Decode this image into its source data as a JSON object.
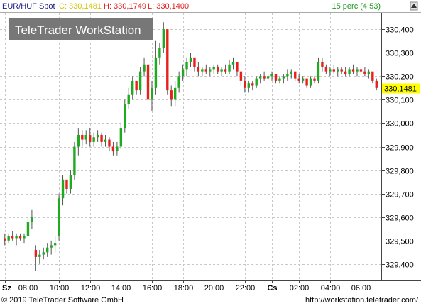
{
  "header": {
    "symbol": "EUR/HUF Spot",
    "close_label": "C: 330,1481",
    "high_label": "H: 330,1749",
    "low_label": "L: 330,1400",
    "interval": "15 perc (4:53)"
  },
  "watermark": "TeleTrader WorkStation",
  "footer": {
    "copyright": "© 2019 TeleTrader Software GmbH",
    "url": "http://workstation.teletrader.com/"
  },
  "colors": {
    "up": "#1faa1f",
    "down": "#e8201a",
    "wick": "#555555",
    "grid": "#c8c8c8",
    "last_price_bg": "#ffff00",
    "close_text": "#d4c400",
    "high_low_text": "#e02020",
    "interval_text": "#1f9a1f",
    "watermark_bg": "#777777"
  },
  "chart_data": {
    "type": "candlestick",
    "title": "EUR/HUF Spot",
    "interval": "15 perc",
    "ylim": [
      329.33,
      330.47
    ],
    "y_ticks": [
      "329,400",
      "329,500",
      "329,600",
      "329,700",
      "329,800",
      "329,900",
      "330,000",
      "330,100",
      "330,200",
      "330,300",
      "330,400"
    ],
    "x_ticks": [
      {
        "label": "Sz",
        "pos": 0,
        "bold": true
      },
      {
        "label": "08:00",
        "pos": 6
      },
      {
        "label": "10:00",
        "pos": 14
      },
      {
        "label": "12:00",
        "pos": 22
      },
      {
        "label": "14:00",
        "pos": 30
      },
      {
        "label": "16:00",
        "pos": 38
      },
      {
        "label": "18:00",
        "pos": 46
      },
      {
        "label": "20:00",
        "pos": 54
      },
      {
        "label": "22:00",
        "pos": 62
      },
      {
        "label": "Cs",
        "pos": 69,
        "bold": true
      },
      {
        "label": "02:00",
        "pos": 76
      },
      {
        "label": "04:00",
        "pos": 84
      },
      {
        "label": "06:00",
        "pos": 92
      }
    ],
    "last_price": "330,1481",
    "last_price_value": 330.1481,
    "ohlc": [
      [
        329.51,
        329.53,
        329.48,
        329.5
      ],
      [
        329.5,
        329.53,
        329.49,
        329.52
      ],
      [
        329.52,
        329.54,
        329.5,
        329.51
      ],
      [
        329.51,
        329.53,
        329.48,
        329.52
      ],
      [
        329.52,
        329.53,
        329.5,
        329.51
      ],
      [
        329.51,
        329.53,
        329.49,
        329.52
      ],
      [
        329.52,
        329.6,
        329.52,
        329.58
      ],
      [
        329.58,
        329.63,
        329.55,
        329.6
      ],
      [
        329.46,
        329.48,
        329.37,
        329.43
      ],
      [
        329.43,
        329.46,
        329.4,
        329.44
      ],
      [
        329.44,
        329.47,
        329.42,
        329.45
      ],
      [
        329.45,
        329.49,
        329.43,
        329.47
      ],
      [
        329.47,
        329.5,
        329.44,
        329.48
      ],
      [
        329.48,
        329.52,
        329.45,
        329.49
      ],
      [
        329.52,
        329.7,
        329.5,
        329.68
      ],
      [
        329.68,
        329.78,
        329.65,
        329.76
      ],
      [
        329.76,
        329.74,
        329.7,
        329.72
      ],
      [
        329.72,
        329.8,
        329.7,
        329.78
      ],
      [
        329.78,
        329.92,
        329.76,
        329.9
      ],
      [
        329.9,
        329.98,
        329.86,
        329.95
      ],
      [
        329.95,
        329.97,
        329.9,
        329.93
      ],
      [
        329.93,
        329.97,
        329.91,
        329.95
      ],
      [
        329.95,
        329.98,
        329.9,
        329.92
      ],
      [
        329.92,
        329.96,
        329.9,
        329.94
      ],
      [
        329.94,
        329.97,
        329.92,
        329.95
      ],
      [
        329.95,
        329.96,
        329.9,
        329.92
      ],
      [
        329.92,
        329.95,
        329.9,
        329.93
      ],
      [
        329.93,
        329.94,
        329.88,
        329.9
      ],
      [
        329.9,
        329.92,
        329.86,
        329.88
      ],
      [
        329.88,
        329.92,
        329.86,
        329.9
      ],
      [
        329.9,
        330.0,
        329.89,
        329.98
      ],
      [
        329.98,
        330.1,
        329.96,
        330.08
      ],
      [
        330.08,
        330.15,
        330.06,
        330.12
      ],
      [
        330.12,
        330.2,
        330.1,
        330.18
      ],
      [
        330.18,
        330.16,
        330.12,
        330.14
      ],
      [
        330.14,
        330.24,
        330.12,
        330.22
      ],
      [
        330.22,
        330.28,
        330.2,
        330.25
      ],
      [
        330.25,
        330.2,
        330.08,
        330.1
      ],
      [
        330.1,
        330.18,
        330.05,
        330.15
      ],
      [
        330.15,
        330.35,
        330.12,
        330.28
      ],
      [
        330.28,
        330.34,
        330.25,
        330.32
      ],
      [
        330.32,
        330.43,
        330.3,
        330.4
      ],
      [
        330.4,
        330.3,
        330.12,
        330.14
      ],
      [
        330.14,
        330.16,
        330.07,
        330.1
      ],
      [
        330.1,
        330.18,
        330.07,
        330.15
      ],
      [
        330.15,
        330.22,
        330.13,
        330.2
      ],
      [
        330.2,
        330.25,
        330.18,
        330.23
      ],
      [
        330.23,
        330.28,
        330.2,
        330.26
      ],
      [
        330.26,
        330.3,
        330.24,
        330.28
      ],
      [
        330.28,
        330.26,
        330.22,
        330.24
      ],
      [
        330.24,
        330.26,
        330.2,
        330.22
      ],
      [
        330.22,
        330.24,
        330.2,
        330.23
      ],
      [
        330.23,
        330.25,
        330.21,
        330.22
      ],
      [
        330.22,
        330.24,
        330.2,
        330.23
      ],
      [
        330.23,
        330.25,
        330.21,
        330.24
      ],
      [
        330.24,
        330.25,
        330.21,
        330.22
      ],
      [
        330.22,
        330.24,
        330.2,
        330.23
      ],
      [
        330.23,
        330.25,
        330.21,
        330.22
      ],
      [
        330.22,
        330.27,
        330.21,
        330.25
      ],
      [
        330.25,
        330.28,
        330.23,
        330.26
      ],
      [
        330.26,
        330.24,
        330.2,
        330.22
      ],
      [
        330.22,
        330.2,
        330.16,
        330.18
      ],
      [
        330.18,
        330.2,
        330.13,
        330.15
      ],
      [
        330.15,
        330.18,
        330.13,
        330.17
      ],
      [
        330.17,
        330.18,
        330.14,
        330.16
      ],
      [
        330.16,
        330.2,
        330.15,
        330.19
      ],
      [
        330.19,
        330.21,
        330.17,
        330.2
      ],
      [
        330.2,
        330.22,
        330.18,
        330.19
      ],
      [
        330.19,
        330.21,
        330.18,
        330.2
      ],
      [
        330.2,
        330.22,
        330.18,
        330.21
      ],
      [
        330.21,
        330.2,
        330.17,
        330.18
      ],
      [
        330.18,
        330.2,
        330.17,
        330.19
      ],
      [
        330.19,
        330.21,
        330.17,
        330.2
      ],
      [
        330.2,
        330.23,
        330.18,
        330.21
      ],
      [
        330.21,
        330.23,
        330.19,
        330.22
      ],
      [
        330.22,
        330.21,
        330.18,
        330.19
      ],
      [
        330.19,
        330.21,
        330.17,
        330.18
      ],
      [
        330.18,
        330.2,
        330.17,
        330.19
      ],
      [
        330.19,
        330.18,
        330.15,
        330.16
      ],
      [
        330.16,
        330.2,
        330.15,
        330.19
      ],
      [
        330.19,
        330.2,
        330.17,
        330.18
      ],
      [
        330.18,
        330.28,
        330.17,
        330.26
      ],
      [
        330.26,
        330.28,
        330.22,
        330.24
      ],
      [
        330.24,
        330.25,
        330.21,
        330.22
      ],
      [
        330.22,
        330.24,
        330.2,
        330.23
      ],
      [
        330.23,
        330.25,
        330.21,
        330.22
      ],
      [
        330.22,
        330.24,
        330.2,
        330.23
      ],
      [
        330.23,
        330.24,
        330.21,
        330.22
      ],
      [
        330.22,
        330.24,
        330.2,
        330.21
      ],
      [
        330.21,
        330.24,
        330.2,
        330.23
      ],
      [
        330.23,
        330.25,
        330.21,
        330.22
      ],
      [
        330.22,
        330.24,
        330.2,
        330.23
      ],
      [
        330.23,
        330.24,
        330.21,
        330.22
      ],
      [
        330.22,
        330.24,
        330.2,
        330.21
      ],
      [
        330.21,
        330.23,
        330.19,
        330.22
      ],
      [
        330.22,
        330.21,
        330.17,
        330.18
      ],
      [
        330.18,
        330.19,
        330.14,
        330.15
      ]
    ]
  }
}
